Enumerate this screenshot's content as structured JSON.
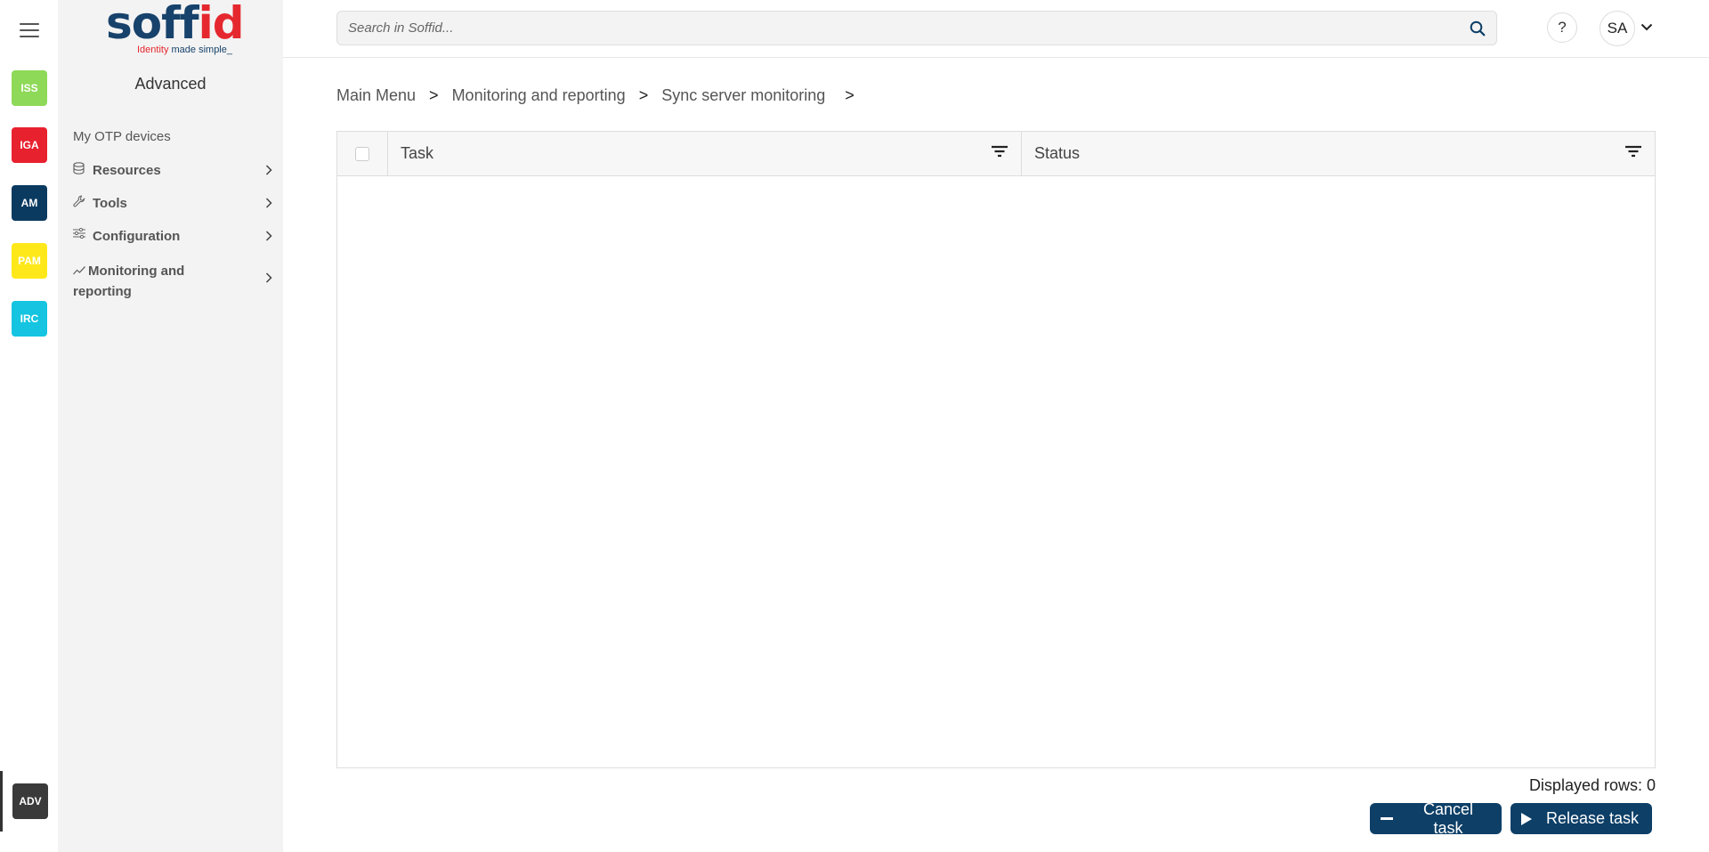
{
  "apps": [
    {
      "label": "ISS",
      "color": "#8ed957"
    },
    {
      "label": "IGA",
      "color": "#e8212f"
    },
    {
      "label": "AM",
      "color": "#0b3a60"
    },
    {
      "label": "PAM",
      "color": "#ffe81a"
    },
    {
      "label": "IRC",
      "color": "#14c4e0"
    }
  ],
  "active_app": {
    "label": "ADV",
    "color": "#3a3a3a"
  },
  "logo": {
    "brand_a": "soff",
    "brand_b": "id",
    "tagline_a": "Identity",
    "tagline_b": " made simple_"
  },
  "sidebar": {
    "title": "Advanced",
    "otp": "My OTP devices",
    "items": [
      {
        "label": "Resources",
        "icon": "database-icon"
      },
      {
        "label": "Tools",
        "icon": "wrench-icon"
      },
      {
        "label": "Configuration",
        "icon": "sliders-icon"
      },
      {
        "label": "Monitoring and reporting",
        "icon": "chart-line-icon"
      }
    ]
  },
  "search": {
    "placeholder": "Search in Soffid..."
  },
  "header": {
    "help": "?",
    "user": "SA"
  },
  "breadcrumb": {
    "items": [
      "Main Menu",
      "Monitoring and reporting",
      "Sync server monitoring"
    ],
    "separator": ">"
  },
  "table": {
    "columns": [
      "Task",
      "Status"
    ],
    "rows": [],
    "displayed_rows": "Displayed rows: 0"
  },
  "actions": {
    "cancel": "Cancel task",
    "release": "Release task"
  }
}
